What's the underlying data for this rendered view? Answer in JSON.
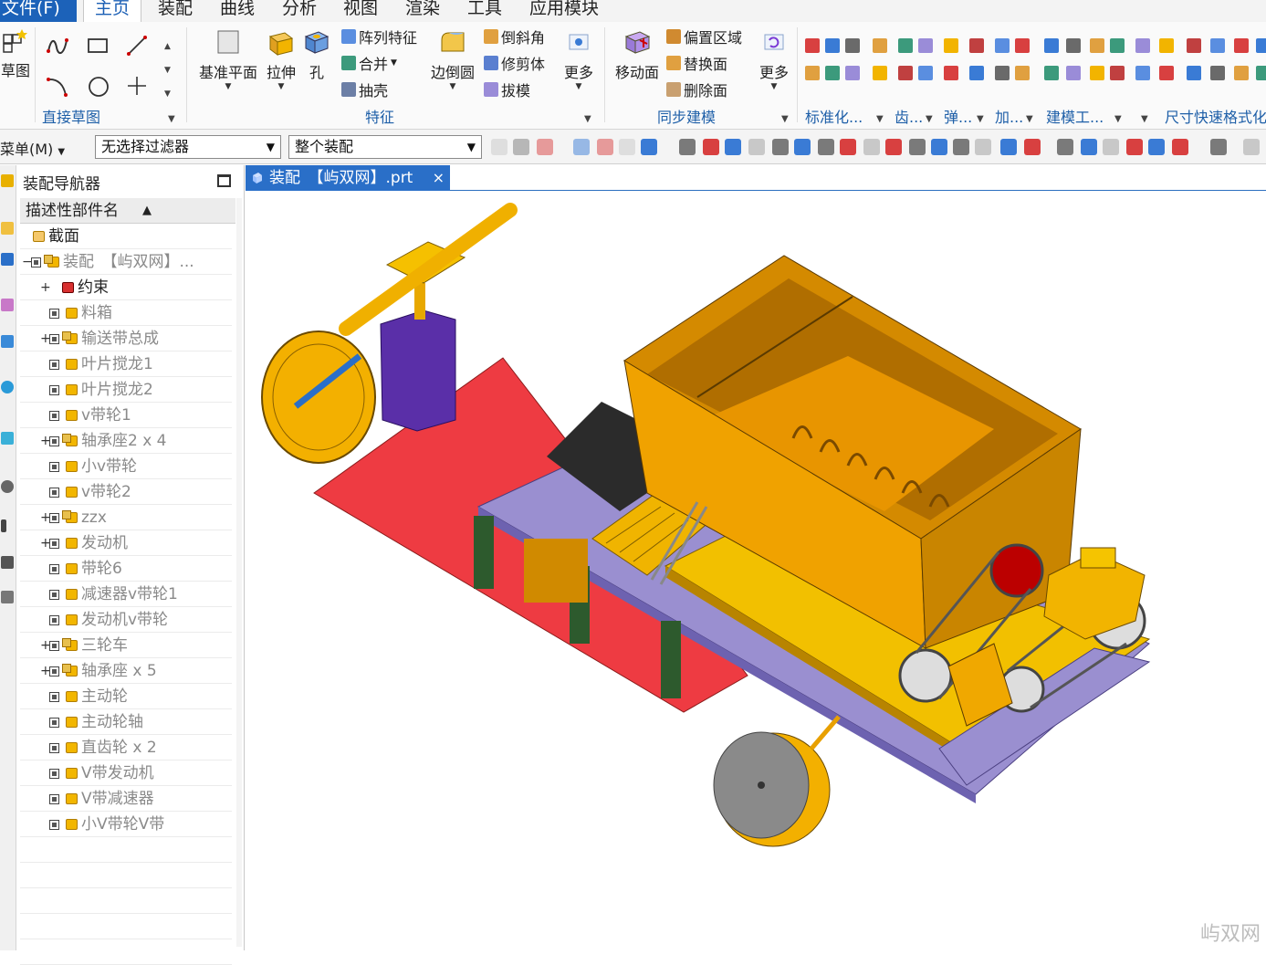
{
  "menubar": {
    "file": "文件(F)",
    "tabs": [
      "主页",
      "装配",
      "曲线",
      "分析",
      "视图",
      "渲染",
      "工具",
      "应用模块"
    ]
  },
  "ribbon": {
    "sketch": {
      "label": "草图"
    },
    "direct_sketch": {
      "group_label": "直接草图"
    },
    "feature": {
      "group_label": "特征",
      "datum_plane": "基准平面",
      "extrude": "拉伸",
      "hole": "孔",
      "pattern": "阵列特征",
      "unite": "合并",
      "shell": "抽壳",
      "edge_blend": "边倒圆",
      "chamfer": "倒斜角",
      "trim_body": "修剪体",
      "draft": "拔模",
      "more": "更多"
    },
    "sync": {
      "group_label": "同步建模",
      "move_face": "移动面",
      "offset_region": "偏置区域",
      "replace_face": "替换面",
      "delete_face": "删除面",
      "more": "更多"
    },
    "standard": {
      "group_label": "标准化..."
    },
    "gear": {
      "group_label": "齿..."
    },
    "spring": {
      "group_label": "弹..."
    },
    "add": {
      "group_label": "加..."
    },
    "modeling_tools": {
      "group_label": "建模工..."
    },
    "dim_format": {
      "group_label": "尺寸快速格式化"
    }
  },
  "selbar": {
    "menu": "菜单(M)",
    "filter": "无选择过滤器",
    "scope": "整个装配"
  },
  "navigator": {
    "title": "装配导航器",
    "column": "描述性部件名",
    "rows": [
      {
        "label": "截面",
        "indent": 0,
        "expander": "",
        "type": "folder",
        "dim": false
      },
      {
        "label": "装配　【屿双网】...",
        "indent": 0,
        "expander": "−",
        "type": "assembly",
        "dim": true
      },
      {
        "label": "约束",
        "indent": 1,
        "expander": "+",
        "type": "constraint",
        "dim": false
      },
      {
        "label": "料箱",
        "indent": 1,
        "expander": "",
        "type": "part",
        "dim": true
      },
      {
        "label": "输送带总成",
        "indent": 1,
        "expander": "+",
        "type": "assembly",
        "dim": true
      },
      {
        "label": "叶片搅龙1",
        "indent": 1,
        "expander": "",
        "type": "part",
        "dim": true
      },
      {
        "label": "叶片搅龙2",
        "indent": 1,
        "expander": "",
        "type": "part",
        "dim": true
      },
      {
        "label": "v带轮1",
        "indent": 1,
        "expander": "",
        "type": "part",
        "dim": true
      },
      {
        "label": "轴承座2 x 4",
        "indent": 1,
        "expander": "+",
        "type": "assembly",
        "dim": true
      },
      {
        "label": "小v带轮",
        "indent": 1,
        "expander": "",
        "type": "part",
        "dim": true
      },
      {
        "label": "v带轮2",
        "indent": 1,
        "expander": "",
        "type": "part",
        "dim": true
      },
      {
        "label": "zzx",
        "indent": 1,
        "expander": "+",
        "type": "assembly",
        "dim": true
      },
      {
        "label": "发动机",
        "indent": 1,
        "expander": "+",
        "type": "part",
        "dim": true
      },
      {
        "label": "带轮6",
        "indent": 1,
        "expander": "",
        "type": "part",
        "dim": true
      },
      {
        "label": "减速器v带轮1",
        "indent": 1,
        "expander": "",
        "type": "part",
        "dim": true
      },
      {
        "label": "发动机v带轮",
        "indent": 1,
        "expander": "",
        "type": "part",
        "dim": true
      },
      {
        "label": "三轮车",
        "indent": 1,
        "expander": "+",
        "type": "assembly",
        "dim": true
      },
      {
        "label": "轴承座 x 5",
        "indent": 1,
        "expander": "+",
        "type": "assembly",
        "dim": true
      },
      {
        "label": "主动轮",
        "indent": 1,
        "expander": "",
        "type": "part",
        "dim": true
      },
      {
        "label": "主动轮轴",
        "indent": 1,
        "expander": "",
        "type": "part",
        "dim": true
      },
      {
        "label": "直齿轮 x 2",
        "indent": 1,
        "expander": "",
        "type": "part",
        "dim": true
      },
      {
        "label": "V带发动机",
        "indent": 1,
        "expander": "",
        "type": "part",
        "dim": true
      },
      {
        "label": "V带减速器",
        "indent": 1,
        "expander": "",
        "type": "part",
        "dim": true
      },
      {
        "label": "小V带轮V带",
        "indent": 1,
        "expander": "",
        "type": "part",
        "dim": true
      }
    ]
  },
  "graphics": {
    "tab_label": "装配　【屿双网】.prt",
    "close": "×",
    "watermark": "屿双网"
  },
  "colors": {
    "accent_blue": "#1c62b9",
    "tab_blue": "#2a6fc8",
    "model_orange": "#e8a400",
    "base_red": "#ee3b42",
    "frame_purple": "#9a8fd0",
    "post_purple": "#5a2fa8"
  }
}
